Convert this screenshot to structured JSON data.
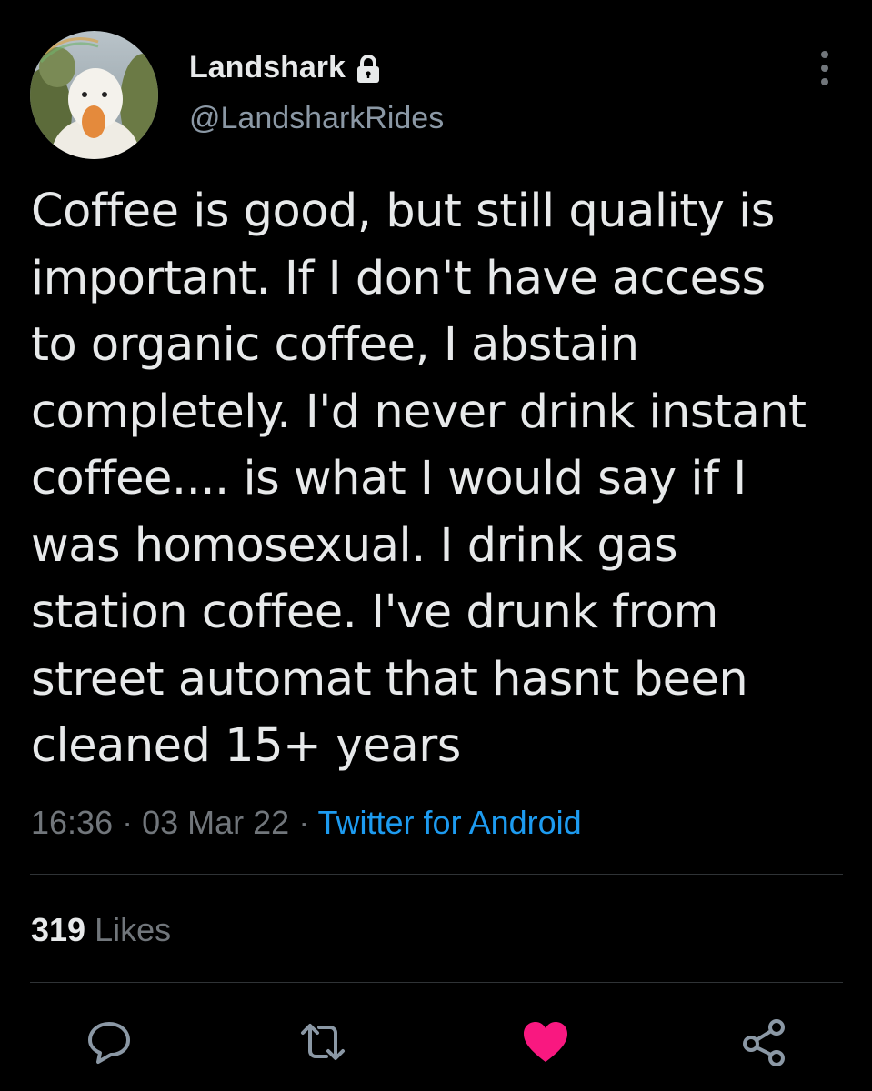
{
  "author": {
    "display_name": "Landshark",
    "handle": "@LandsharkRides",
    "protected_icon": "lock-icon",
    "avatar": "duck-avatar"
  },
  "tweet": {
    "text": "Coffee is good, but still quality is\nimportant. If I don't have access\nto organic coffee, I abstain\ncompletely. I'd never drink instant\ncoffee.... is what I would say if I\nwas homosexual. I drink gas\nstation coffee. I've drunk from\nstreet automat that hasnt been\ncleaned 15+ years",
    "time": "16:36",
    "separator": " · ",
    "date": "03 Mar 22",
    "source": "Twitter for Android"
  },
  "stats": {
    "likes_count": "319",
    "likes_label": "Likes"
  },
  "actions": [
    {
      "name": "reply",
      "icon": "speech-bubble-icon"
    },
    {
      "name": "retweet",
      "icon": "retweet-icon"
    },
    {
      "name": "like",
      "icon": "heart-icon",
      "active": true
    },
    {
      "name": "share",
      "icon": "share-icon"
    }
  ],
  "colors": {
    "background": "#000000",
    "text": "#e7e9ea",
    "secondary": "#71767b",
    "link": "#1d9bf0",
    "like_active": "#f91880",
    "divider": "#2f3336"
  }
}
